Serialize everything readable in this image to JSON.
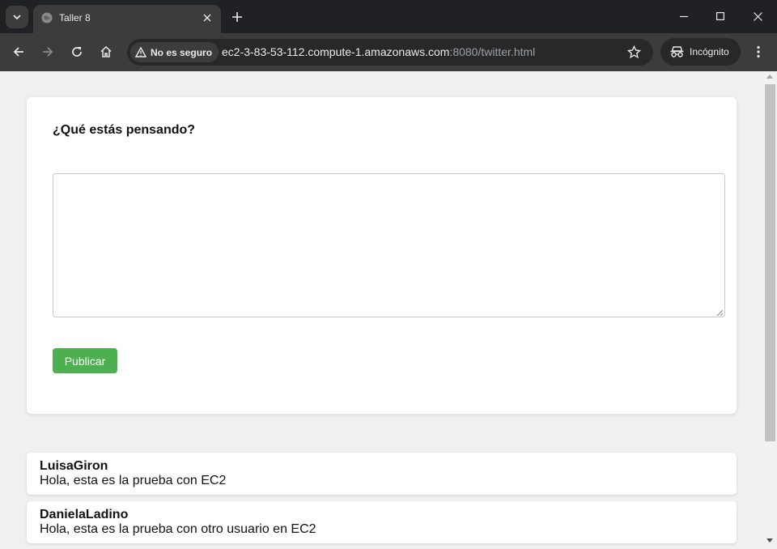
{
  "browser": {
    "tab_title": "Taller 8",
    "security_label": "No es seguro",
    "url_host": "ec2-3-83-53-112.compute-1.amazonaws.com",
    "url_rest": ":8080/twitter.html",
    "incognito_label": "Incógnito"
  },
  "compose": {
    "title": "¿Qué estás pensando?",
    "textarea_value": "",
    "publish_label": "Publicar"
  },
  "posts": [
    {
      "user": "LuisaGiron",
      "text": "Hola, esta es la prueba con EC2"
    },
    {
      "user": "DanielaLadino",
      "text": "Hola, esta es la prueba con otro usuario en EC2"
    }
  ],
  "colors": {
    "publish_button": "#4caf50",
    "page_background": "#f0f0f0",
    "browser_chrome": "#3c3c3c"
  },
  "icons": [
    "tab-search-icon",
    "globe-icon",
    "close-icon",
    "plus-icon",
    "minimize-icon",
    "maximize-icon",
    "back-icon",
    "forward-icon",
    "reload-icon",
    "home-icon",
    "warning-icon",
    "star-icon",
    "incognito-icon",
    "more-icon"
  ]
}
